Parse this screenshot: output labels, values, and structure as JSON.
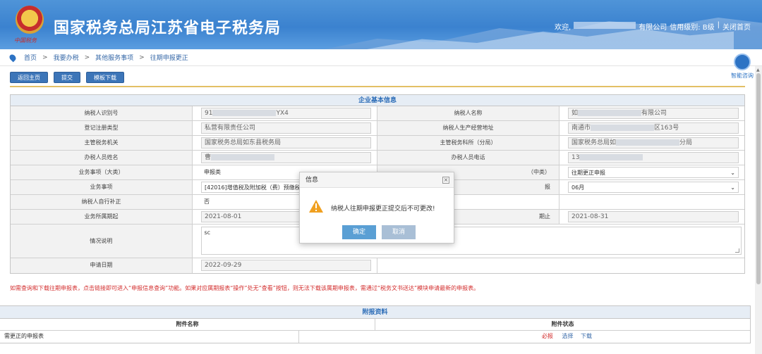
{
  "header": {
    "site_title": "国家税务总局江苏省电子税务局",
    "emblem_text": "中国税务",
    "welcome": "欢迎,",
    "company_suffix": "有限公司",
    "credit_level": "信用级别: B级",
    "separator": "|",
    "close_page": "关闭首页"
  },
  "breadcrumb": [
    "首页",
    "我要办税",
    "其他服务事项",
    "往期申报更正"
  ],
  "assistant_label": "智能咨询",
  "toolbar": {
    "back": "返回主页",
    "submit": "提交",
    "template_download": "模板下载"
  },
  "panel_title": "企业基本信息",
  "fields": {
    "taxpayer_id_label": "纳税人识别号",
    "taxpayer_id_prefix": "91",
    "taxpayer_id_suffix": "YX4",
    "taxpayer_name_label": "纳税人名称",
    "taxpayer_name_prefix": "如",
    "taxpayer_name_suffix": "有限公司",
    "reg_type_label": "登记注册类型",
    "reg_type": "私营有限责任公司",
    "address_label": "纳税人生产经营地址",
    "address_prefix": "南通市",
    "address_suffix": "区163号",
    "tax_office_label": "主管税务机关",
    "tax_office": "国家税务总局如东县税务局",
    "tax_section_label": "主管税务科所（分局）",
    "tax_section_prefix": "国家税务总局如",
    "tax_section_suffix": "分局",
    "handler_name_label": "办税人员姓名",
    "handler_name_prefix": "曹",
    "handler_phone_label": "办税人员电话",
    "handler_phone_prefix": "13",
    "category_big_label": "业务事项（大类）",
    "category_big": "申报类",
    "category_mid_label": "（中类）",
    "category_mid": "往期更正申报",
    "item_label": "业务事项",
    "item": "[42016]增值税及附加税（费）预缴税",
    "period_label": "报",
    "period": "06月",
    "self_correct_label": "纳税人自行补正",
    "self_correct": "否",
    "start_label": "业务所属期起",
    "start_date": "2021-08-01",
    "end_label": "期止",
    "end_date": "2021-08-31",
    "desc_label": "情况说明",
    "desc": "sc",
    "apply_date_label": "申请日期",
    "apply_date": "2022-09-29"
  },
  "notice": "如需查询和下载往期申报表，点击链接即可进入“申报信息查询”功能。如果对应属期报表“操作”处无“查看”按钮，则无法下载该属期申报表，需通过“税务文书送达”模块申请最新的申报表。",
  "attachments": {
    "title": "附报资料",
    "col_name": "附件名称",
    "col_status": "附件状态",
    "rows": [
      {
        "name": "需更正的申报表",
        "required": "必报",
        "select": "选择",
        "download": "下载"
      }
    ]
  },
  "dialog": {
    "title": "信息",
    "close": "×",
    "message": "纳税人往期申报更正提交后不可更改!",
    "ok": "确定",
    "cancel": "取消"
  },
  "colors": {
    "header_blue": "#3b82cf",
    "button_blue": "#3c75b8",
    "warning_red": "#d32e2e",
    "ok_button": "#5a9fd4"
  }
}
